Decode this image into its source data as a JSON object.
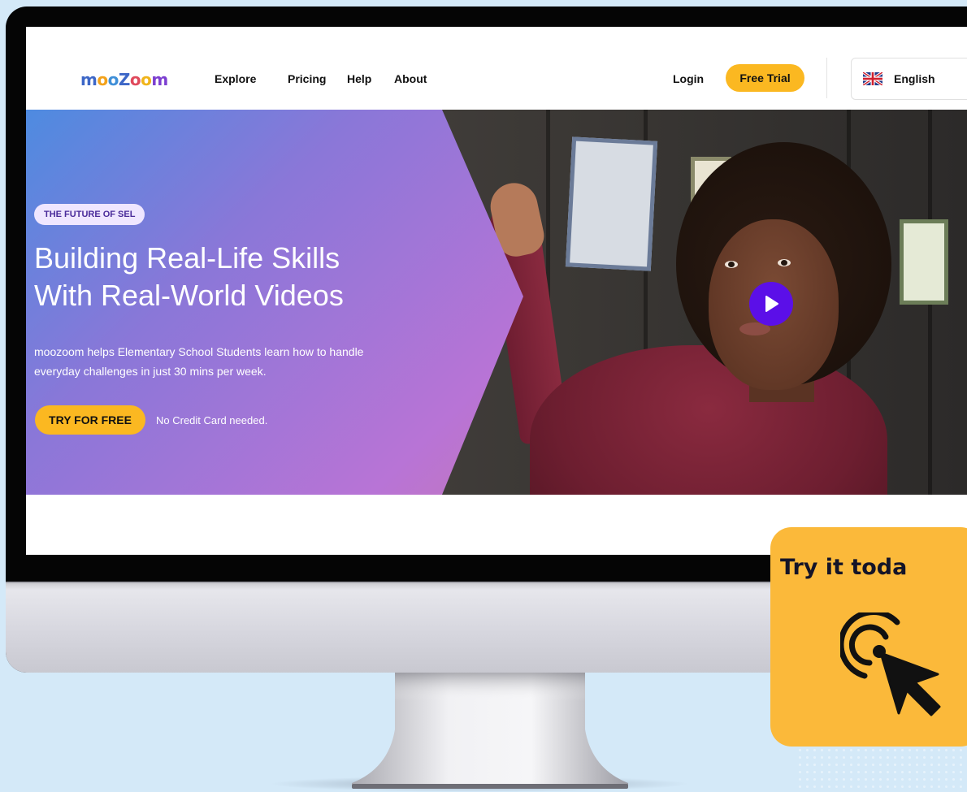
{
  "nav": {
    "logo": [
      "m",
      "o",
      "o",
      "Z",
      "o",
      "o",
      "m"
    ],
    "logo_colors": [
      "#3d67c7",
      "#f3a21a",
      "#3f8fd8",
      "#3d67c7",
      "#e04a5c",
      "#f0b41a",
      "#7c3fd0"
    ],
    "links": [
      "Explore",
      "Pricing",
      "Help",
      "About"
    ],
    "login": "Login",
    "free_trial": "Free Trial",
    "language": "English",
    "language_icon": "uk-flag-icon"
  },
  "hero": {
    "badge": "THE FUTURE OF SEL",
    "headline_line1": "Building Real-Life Skills",
    "headline_line2": "With Real-World Videos",
    "sub_line1": "moozoom helps Elementary School Students learn how to handle",
    "sub_line2": "everyday challenges in just 30 mins per week.",
    "cta": "TRY FOR FREE",
    "cta_note": "No Credit Card needed.",
    "play_icon": "play-icon"
  },
  "overlay": {
    "title": "Try it toda",
    "icon": "click-cursor-icon"
  },
  "colors": {
    "accent_yellow": "#fbb821",
    "play_purple": "#5b0fe8",
    "background": "#d4e9f8"
  }
}
